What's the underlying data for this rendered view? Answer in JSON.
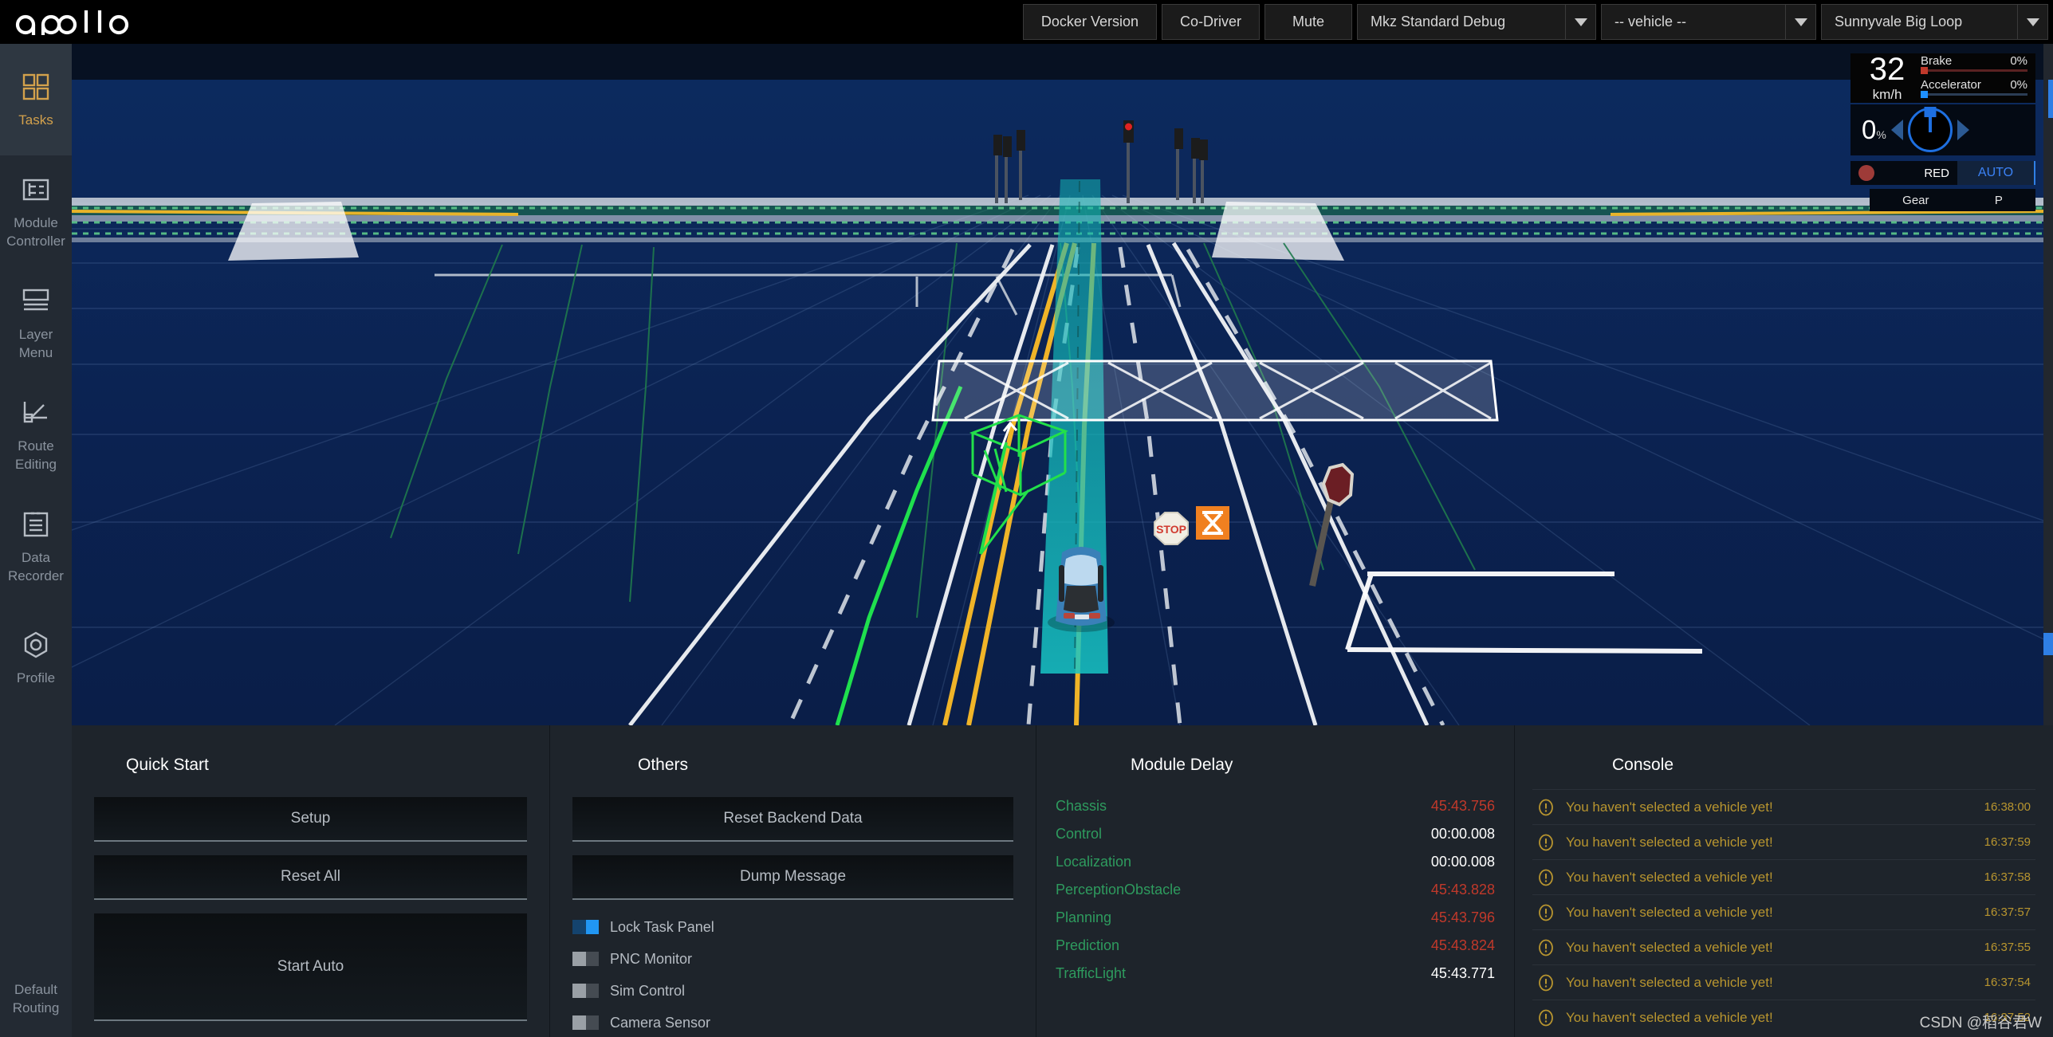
{
  "brand": {
    "name": "apollo"
  },
  "topbar": {
    "buttons": [
      {
        "label": "Docker Version",
        "name": "docker-version-button"
      },
      {
        "label": "Co-Driver",
        "name": "co-driver-button"
      },
      {
        "label": "Mute",
        "name": "mute-button"
      }
    ],
    "selects": [
      {
        "value": "Mkz Standard Debug",
        "name": "mode-select"
      },
      {
        "value": "-- vehicle --",
        "name": "vehicle-select"
      },
      {
        "value": "Sunnyvale Big Loop",
        "name": "map-select"
      }
    ]
  },
  "sidebar": {
    "items": [
      {
        "label": "Tasks",
        "icon": "grid-icon",
        "active": true
      },
      {
        "label": "Module\nController",
        "icon": "module-icon",
        "active": false
      },
      {
        "label": "Layer\nMenu",
        "icon": "layers-icon",
        "active": false
      },
      {
        "label": "Route\nEditing",
        "icon": "route-icon",
        "active": false
      },
      {
        "label": "Data\nRecorder",
        "icon": "record-icon",
        "active": false
      },
      {
        "label": "Profile",
        "icon": "profile-icon",
        "active": false
      }
    ],
    "bottom": {
      "label": "Default\nRouting",
      "name": "default-routing-button"
    }
  },
  "hud": {
    "speed": {
      "value": "32",
      "unit": "km/h"
    },
    "brake": {
      "label": "Brake",
      "value": "0%",
      "percent": 0
    },
    "accelerator": {
      "label": "Accelerator",
      "value": "0%",
      "percent": 0
    },
    "steering": {
      "value": "0",
      "unit": "%"
    },
    "traffic_light": {
      "label": "RED",
      "color": "#9e3b38"
    },
    "driving_mode": {
      "label": "AUTO",
      "color": "#3b82f6"
    },
    "gear": {
      "label": "Gear",
      "value": "P"
    }
  },
  "panels": {
    "quick_start": {
      "title": "Quick Start",
      "buttons": [
        {
          "label": "Setup",
          "name": "setup-button"
        },
        {
          "label": "Reset All",
          "name": "reset-all-button"
        },
        {
          "label": "Start Auto",
          "name": "start-auto-button"
        }
      ]
    },
    "others": {
      "title": "Others",
      "buttons": [
        {
          "label": "Reset Backend Data",
          "name": "reset-backend-data-button"
        },
        {
          "label": "Dump Message",
          "name": "dump-message-button"
        }
      ],
      "toggles": [
        {
          "label": "Lock Task Panel",
          "on": true,
          "name": "toggle-lock-task-panel"
        },
        {
          "label": "PNC Monitor",
          "on": false,
          "name": "toggle-pnc-monitor"
        },
        {
          "label": "Sim Control",
          "on": false,
          "name": "toggle-sim-control"
        },
        {
          "label": "Camera Sensor",
          "on": false,
          "name": "toggle-camera-sensor"
        }
      ]
    },
    "module_delay": {
      "title": "Module Delay",
      "rows": [
        {
          "name": "Chassis",
          "value": "45:43.756",
          "status": "red"
        },
        {
          "name": "Control",
          "value": "00:00.008",
          "status": "white"
        },
        {
          "name": "Localization",
          "value": "00:00.008",
          "status": "white"
        },
        {
          "name": "PerceptionObstacle",
          "value": "45:43.828",
          "status": "red"
        },
        {
          "name": "Planning",
          "value": "45:43.796",
          "status": "red"
        },
        {
          "name": "Prediction",
          "value": "45:43.824",
          "status": "red"
        },
        {
          "name": "TrafficLight",
          "value": "45:43.771",
          "status": "white"
        }
      ]
    },
    "console": {
      "title": "Console",
      "entries": [
        {
          "message": "You haven't selected a vehicle yet!",
          "time": "16:38:00"
        },
        {
          "message": "You haven't selected a vehicle yet!",
          "time": "16:37:59"
        },
        {
          "message": "You haven't selected a vehicle yet!",
          "time": "16:37:58"
        },
        {
          "message": "You haven't selected a vehicle yet!",
          "time": "16:37:57"
        },
        {
          "message": "You haven't selected a vehicle yet!",
          "time": "16:37:55"
        },
        {
          "message": "You haven't selected a vehicle yet!",
          "time": "16:37:54"
        },
        {
          "message": "You haven't selected a vehicle yet!",
          "time": "16:37:52"
        }
      ]
    }
  },
  "scene": {
    "stop_sign_label": "STOP",
    "background_color": "#0b2049"
  },
  "watermark": {
    "text": "CSDN @稻谷君W"
  }
}
